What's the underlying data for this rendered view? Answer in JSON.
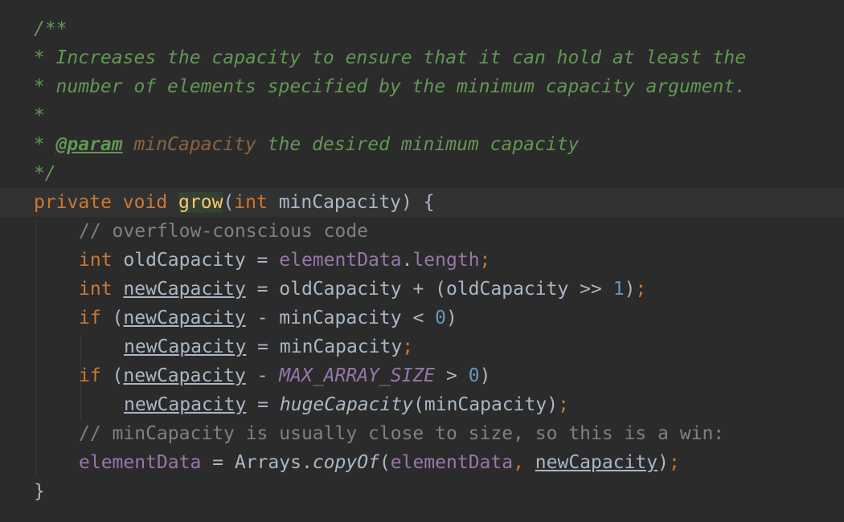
{
  "editor": {
    "doc": {
      "open": "/**",
      "line1": " * Increases the capacity to ensure that it can hold at least the",
      "line2": " * number of elements specified by the minimum capacity argument.",
      "line3": " *",
      "line4_prefix": " * ",
      "line4_tag": "@param",
      "line4_param": "minCapacity",
      "line4_rest": " the desired minimum capacity",
      "close": " */"
    },
    "signature": {
      "modifier": "private",
      "return_type": "void",
      "method_name": "grow",
      "open_paren": "(",
      "param_type": "int",
      "param_name": " minCapacity",
      "close": ") {"
    },
    "body": {
      "comment1": "// overflow-conscious code",
      "l2_type": "int",
      "l2_var": " oldCapacity = ",
      "l2_field": "elementData",
      "l2_dot": ".",
      "l2_prop": "length",
      "semi": ";",
      "l3_type": "int",
      "l3_var": "newCapacity",
      "l3_expr": " = oldCapacity + (oldCapacity >> ",
      "l3_num": "1",
      "l3_close": ")",
      "l4_kw": "if",
      "l4_open": " (",
      "l4_var": "newCapacity",
      "l4_expr": " - minCapacity < ",
      "l4_num": "0",
      "l4_close": ")",
      "l5_var": "newCapacity",
      "l5_expr": " = minCapacity",
      "l6_kw": "if",
      "l6_open": " (",
      "l6_var": "newCapacity",
      "l6_minus": " - ",
      "l6_const": "MAX_ARRAY_SIZE",
      "l6_expr": " > ",
      "l6_num": "0",
      "l6_close": ")",
      "l7_var": "newCapacity",
      "l7_eq": " = ",
      "l7_call": "hugeCapacity",
      "l7_args": "(minCapacity)",
      "comment2": "// minCapacity is usually close to size, so this is a win:",
      "l9_field": "elementData",
      "l9_eq": " = Arrays.",
      "l9_call": "copyOf",
      "l9_open": "(",
      "l9_arg1": "elementData",
      "l9_comma": ", ",
      "l9_arg2": "newCapacity",
      "l9_close": ")"
    },
    "closing_brace": "}"
  }
}
